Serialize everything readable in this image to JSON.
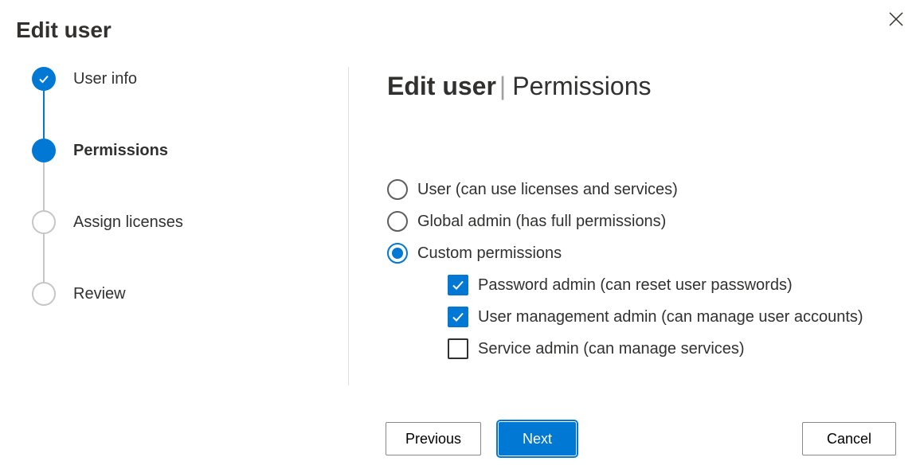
{
  "dialog": {
    "title": "Edit user"
  },
  "steps": [
    {
      "label": "User info",
      "state": "completed"
    },
    {
      "label": "Permissions",
      "state": "current"
    },
    {
      "label": "Assign licenses",
      "state": "pending"
    },
    {
      "label": "Review",
      "state": "pending"
    }
  ],
  "page": {
    "heading_prefix": "Edit user",
    "heading_separator": "|",
    "heading_section": "Permissions"
  },
  "permissions": {
    "role_options": [
      {
        "label": "User (can use licenses and services)",
        "selected": false
      },
      {
        "label": "Global admin (has full permissions)",
        "selected": false
      },
      {
        "label": "Custom permissions",
        "selected": true
      }
    ],
    "custom_options": [
      {
        "label": "Password admin (can reset user passwords)",
        "checked": true
      },
      {
        "label": "User management admin (can manage user accounts)",
        "checked": true
      },
      {
        "label": "Service admin (can manage services)",
        "checked": false
      }
    ]
  },
  "footer": {
    "previous": "Previous",
    "next": "Next",
    "cancel": "Cancel"
  }
}
